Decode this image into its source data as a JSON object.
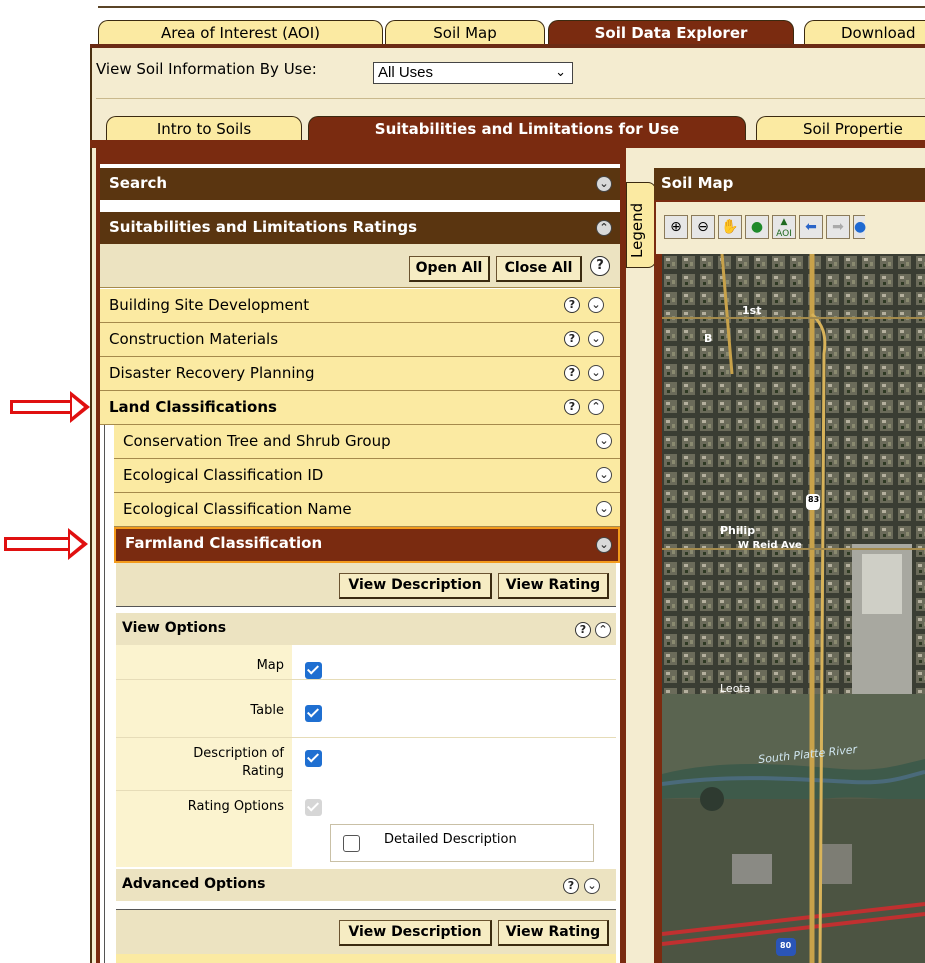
{
  "top_tabs": [
    {
      "label": "Area of Interest (AOI)",
      "active": false
    },
    {
      "label": "Soil Map",
      "active": false
    },
    {
      "label": "Soil Data Explorer",
      "active": true
    },
    {
      "label": "Download",
      "active": false
    }
  ],
  "use_selector": {
    "label": "View Soil Information By Use:",
    "value": "All Uses"
  },
  "sub_tabs": [
    {
      "label": "Intro to Soils",
      "active": false
    },
    {
      "label": "Suitabilities and Limitations for Use",
      "active": true
    },
    {
      "label": "Soil Propertie",
      "active": false
    }
  ],
  "left": {
    "search_title": "Search",
    "ratings_title": "Suitabilities and Limitations Ratings",
    "open_all": "Open All",
    "close_all": "Close All",
    "categories": [
      {
        "label": "Building Site Development"
      },
      {
        "label": "Construction Materials"
      },
      {
        "label": "Disaster Recovery Planning"
      },
      {
        "label": "Land Classifications"
      }
    ],
    "subcategories": [
      {
        "label": "Conservation Tree and Shrub Group"
      },
      {
        "label": "Ecological Classification ID"
      },
      {
        "label": "Ecological Classification Name"
      },
      {
        "label": "Farmland Classification"
      }
    ],
    "view_description": "View Description",
    "view_rating": "View Rating",
    "view_options_title": "View Options",
    "options": {
      "map": "Map",
      "table": "Table",
      "description": "Description of Rating",
      "rating_options": "Rating Options",
      "detailed_description": "Detailed Description"
    },
    "options_state": {
      "map": true,
      "table": true,
      "description": true,
      "rating_options": true,
      "detailed_description": false
    },
    "advanced_options_title": "Advanced Options"
  },
  "legend_label": "Legend",
  "map": {
    "title": "Soil Map",
    "labels": {
      "street_1st": "1st",
      "street_b": "B",
      "town": "Philip",
      "avenue": "W Reid Ave",
      "place": "Leota",
      "river": "South Platte River",
      "hwy83": "83",
      "i80": "80"
    }
  },
  "colors": {
    "brand_dark": "#5a3510",
    "accent": "#7a2b10",
    "tab_bg": "#fbeaa2",
    "highlight_border": "#f39b1c",
    "arrow": "#e01010"
  }
}
